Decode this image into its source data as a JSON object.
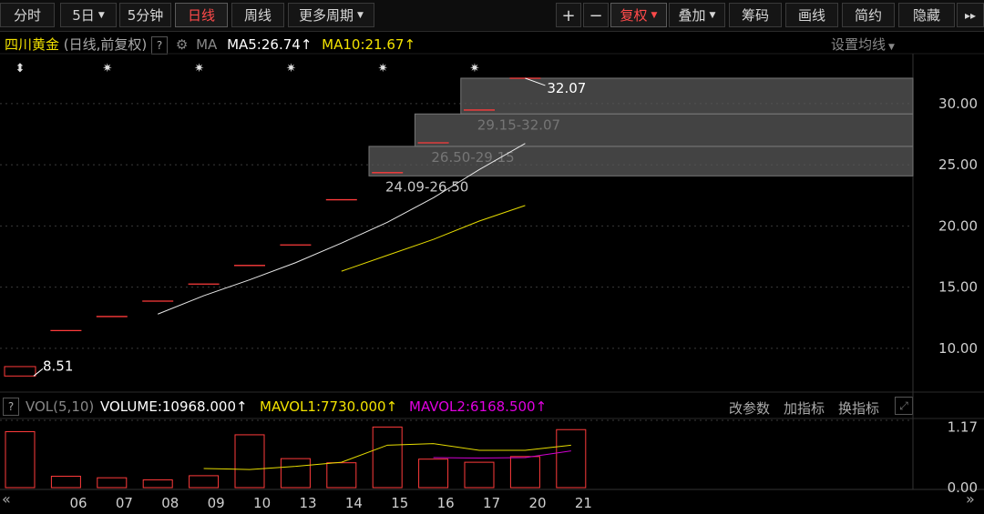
{
  "toolbar": {
    "items": [
      {
        "label": "分时",
        "caret": false,
        "active": false
      },
      {
        "label": "5日",
        "caret": true,
        "active": false
      },
      {
        "label": "5分钟",
        "caret": false,
        "active": false
      },
      {
        "label": "日线",
        "caret": false,
        "active": true
      },
      {
        "label": "周线",
        "caret": false,
        "active": false
      },
      {
        "label": "更多周期",
        "caret": true,
        "active": false
      }
    ],
    "plus": "+",
    "minus": "−",
    "right_items": [
      {
        "label": "复权",
        "caret": true,
        "active": true
      },
      {
        "label": "叠加",
        "caret": true,
        "active": false
      },
      {
        "label": "筹码",
        "caret": false,
        "active": false
      },
      {
        "label": "画线",
        "caret": false,
        "active": false
      },
      {
        "label": "简约",
        "caret": false,
        "active": false
      },
      {
        "label": "隐藏",
        "caret": false,
        "active": false
      }
    ],
    "expand_glyph": "▸▸"
  },
  "header": {
    "stock": "四川黄金",
    "mode": "(日线,前复权)",
    "help": "?",
    "ma_label": "MA",
    "ma5": "MA5:26.74",
    "ma10": "MA10:21.67",
    "arrow": "↑",
    "settings": "设置均线",
    "colors": {
      "ma5": "#ffffff",
      "ma10": "#f3e300",
      "stock": "#f0e000"
    }
  },
  "price_axis": {
    "ticks": [
      "30.00",
      "25.00",
      "20.00",
      "15.00",
      "10.00"
    ]
  },
  "vol_header": {
    "help": "?",
    "vol": "VOL(5,10)",
    "volume": "VOLUME:10968.000",
    "mavol1": "MAVOL1:7730.000",
    "mavol2": "MAVOL2:6168.500",
    "arrow": "↑",
    "btn1": "改参数",
    "btn2": "加指标",
    "btn3": "换指标",
    "colors": {
      "mavol1": "#f3e300",
      "mavol2": "#e000e0"
    }
  },
  "vol_axis": {
    "ticks": [
      "1.17",
      "0.00"
    ]
  },
  "date_axis": {
    "labels": [
      "06",
      "07",
      "08",
      "09",
      "10",
      "13",
      "14",
      "15",
      "16",
      "17",
      "20",
      "21"
    ]
  },
  "chart_data": {
    "type": "candlestick",
    "x": [
      "06",
      "07",
      "08",
      "09",
      "10",
      "13",
      "14",
      "15",
      "16",
      "17",
      "20",
      "21"
    ],
    "pre_first_close": 8.51,
    "close": [
      8.51,
      11.45,
      12.6,
      13.86,
      15.25,
      16.77,
      18.45,
      22.14,
      24.35,
      26.79,
      29.47,
      32.07
    ],
    "open": [
      7.74,
      11.45,
      12.6,
      13.86,
      15.25,
      16.77,
      18.45,
      22.14,
      24.35,
      26.79,
      29.47,
      32.07
    ],
    "high": [
      8.51,
      11.45,
      12.6,
      13.86,
      15.25,
      16.77,
      18.45,
      22.14,
      24.35,
      26.79,
      29.47,
      32.07
    ],
    "low": [
      7.74,
      11.45,
      12.6,
      13.86,
      15.25,
      16.77,
      18.45,
      22.14,
      24.35,
      26.79,
      29.47,
      32.07
    ],
    "ma5": {
      "name": "MA5",
      "x": [
        "09",
        "10",
        "13",
        "14",
        "15",
        "16",
        "17",
        "20",
        "21"
      ],
      "values": [
        12.8,
        14.3,
        15.6,
        17.0,
        18.6,
        20.3,
        22.3,
        24.6,
        26.74
      ]
    },
    "ma10": {
      "name": "MA10",
      "x": [
        "15",
        "16",
        "17",
        "20",
        "21"
      ],
      "values": [
        16.3,
        17.6,
        18.9,
        20.4,
        21.67
      ]
    },
    "annotations": {
      "high": "32.07",
      "low": "8.51"
    },
    "chip_zones": [
      {
        "label": "29.15-32.07",
        "low": 29.15,
        "high": 32.07,
        "start": "20"
      },
      {
        "label": "26.50-29.15",
        "low": 26.5,
        "high": 29.15,
        "start": "17"
      },
      {
        "label": "24.09-26.50",
        "low": 24.09,
        "high": 26.5,
        "start": "16"
      }
    ],
    "event_markers": [
      "06",
      "08",
      "10",
      "14",
      "16",
      "20"
    ],
    "ylim": [
      6.5,
      34
    ],
    "volume": {
      "ylim": [
        0,
        1.3
      ],
      "values": [
        1.08,
        0.22,
        0.19,
        0.15,
        0.23,
        1.02,
        0.56,
        0.48,
        1.17,
        0.55,
        0.49,
        0.6,
        1.12
      ],
      "mavol1": {
        "name": "MAVOL1",
        "values": [
          null,
          null,
          null,
          null,
          0.37,
          0.35,
          0.41,
          0.49,
          0.82,
          0.85,
          0.72,
          0.72,
          0.82
        ]
      },
      "mavol2": {
        "name": "MAVOL2",
        "values": [
          null,
          null,
          null,
          null,
          null,
          null,
          null,
          null,
          null,
          0.58,
          0.57,
          0.58,
          0.71
        ]
      }
    }
  }
}
